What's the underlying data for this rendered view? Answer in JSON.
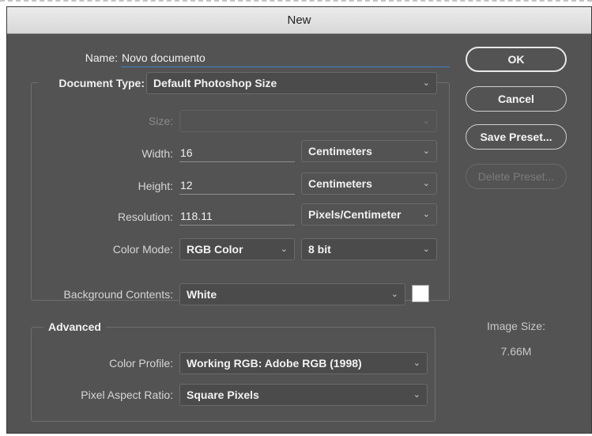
{
  "dialog": {
    "title": "New"
  },
  "name": {
    "label": "Name:",
    "value": "Novo documento"
  },
  "document_type": {
    "label": "Document Type:",
    "value": "Default Photoshop Size"
  },
  "size": {
    "label": "Size:",
    "value": ""
  },
  "width": {
    "label": "Width:",
    "value": "16",
    "unit": "Centimeters"
  },
  "height": {
    "label": "Height:",
    "value": "12",
    "unit": "Centimeters"
  },
  "resolution": {
    "label": "Resolution:",
    "value": "118.11",
    "unit": "Pixels/Centimeter"
  },
  "color_mode": {
    "label": "Color Mode:",
    "value": "RGB Color",
    "bit_depth": "8 bit"
  },
  "background": {
    "label": "Background Contents:",
    "value": "White",
    "swatch_color": "#ffffff"
  },
  "advanced": {
    "title": "Advanced",
    "color_profile": {
      "label": "Color Profile:",
      "value": "Working RGB:  Adobe RGB (1998)"
    },
    "pixel_aspect": {
      "label": "Pixel Aspect Ratio:",
      "value": "Square Pixels"
    }
  },
  "buttons": {
    "ok": "OK",
    "cancel": "Cancel",
    "save_preset": "Save Preset...",
    "delete_preset": "Delete Preset..."
  },
  "image_size": {
    "label": "Image Size:",
    "value": "7.66M"
  },
  "icons": {
    "dropdown": "chevron-down-icon"
  },
  "colors": {
    "dialog_bg": "#535353",
    "focus_underline": "#3f7fd6"
  }
}
